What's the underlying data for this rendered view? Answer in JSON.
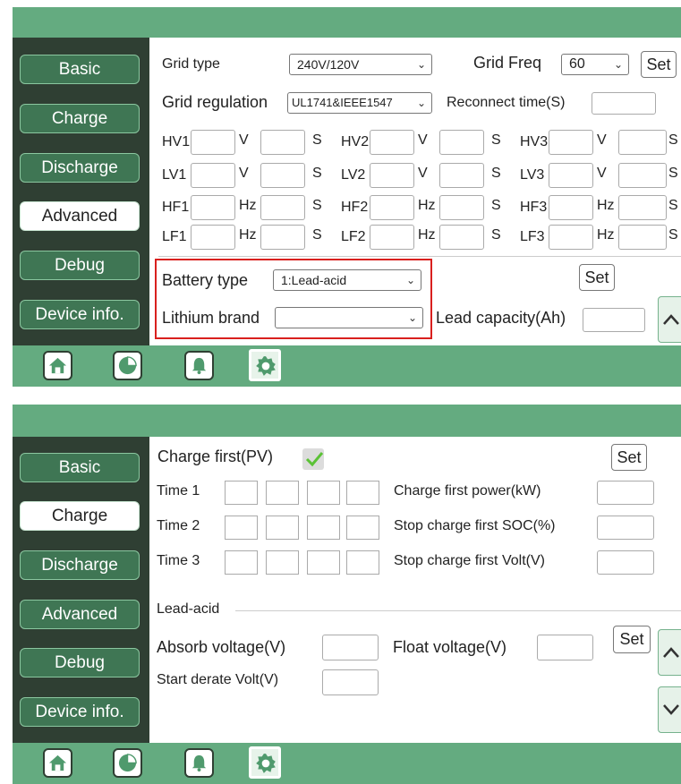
{
  "nav_items": [
    "Basic",
    "Charge",
    "Discharge",
    "Advanced",
    "Debug",
    "Device info."
  ],
  "screen1": {
    "active_nav": "Advanced",
    "grid_type_label": "Grid type",
    "grid_type_value": "240V/120V",
    "grid_freq_label": "Grid Freq",
    "grid_freq_value": "60",
    "set_label": "Set",
    "grid_regulation_label": "Grid regulation",
    "grid_regulation_value": "UL1741&IEEE1547",
    "reconnect_time_label": "Reconnect time(S)",
    "protection_rows": [
      {
        "items": [
          {
            "name": "HV1",
            "unit": "V"
          },
          {
            "name": "HV2",
            "unit": "V"
          },
          {
            "name": "HV3",
            "unit": "V"
          }
        ]
      },
      {
        "items": [
          {
            "name": "LV1",
            "unit": "V"
          },
          {
            "name": "LV2",
            "unit": "V"
          },
          {
            "name": "LV3",
            "unit": "V"
          }
        ]
      },
      {
        "items": [
          {
            "name": "HF1",
            "unit": "Hz"
          },
          {
            "name": "HF2",
            "unit": "Hz"
          },
          {
            "name": "HF3",
            "unit": "Hz"
          }
        ]
      },
      {
        "items": [
          {
            "name": "LF1",
            "unit": "Hz"
          },
          {
            "name": "LF2",
            "unit": "Hz"
          },
          {
            "name": "LF3",
            "unit": "Hz"
          }
        ]
      }
    ],
    "seconds_unit": "S",
    "battery_type_label": "Battery type",
    "battery_type_value": "1:Lead-acid",
    "lithium_brand_label": "Lithium brand",
    "lithium_brand_value": "",
    "lead_capacity_label": "Lead capacity(Ah)"
  },
  "screen2": {
    "active_nav": "Charge",
    "charge_first_label": "Charge first(PV)",
    "charge_first_checked": true,
    "set_label": "Set",
    "time_labels": [
      "Time 1",
      "Time 2",
      "Time 3"
    ],
    "right_labels": [
      "Charge first power(kW)",
      "Stop charge first SOC(%)",
      "Stop charge first Volt(V)"
    ],
    "lead_acid_label": "Lead-acid",
    "absorb_voltage_label": "Absorb voltage(V)",
    "float_voltage_label": "Float voltage(V)",
    "start_derate_label": "Start derate Volt(V)"
  },
  "bottom_icons": [
    "home-icon",
    "pie-chart-icon",
    "bell-icon",
    "gear-icon"
  ],
  "colors": {
    "accent": "#64ab80",
    "sidebar": "#2f3f33",
    "nav_button": "#3f7654",
    "highlight": "#d9201e",
    "check": "#5bc236"
  }
}
